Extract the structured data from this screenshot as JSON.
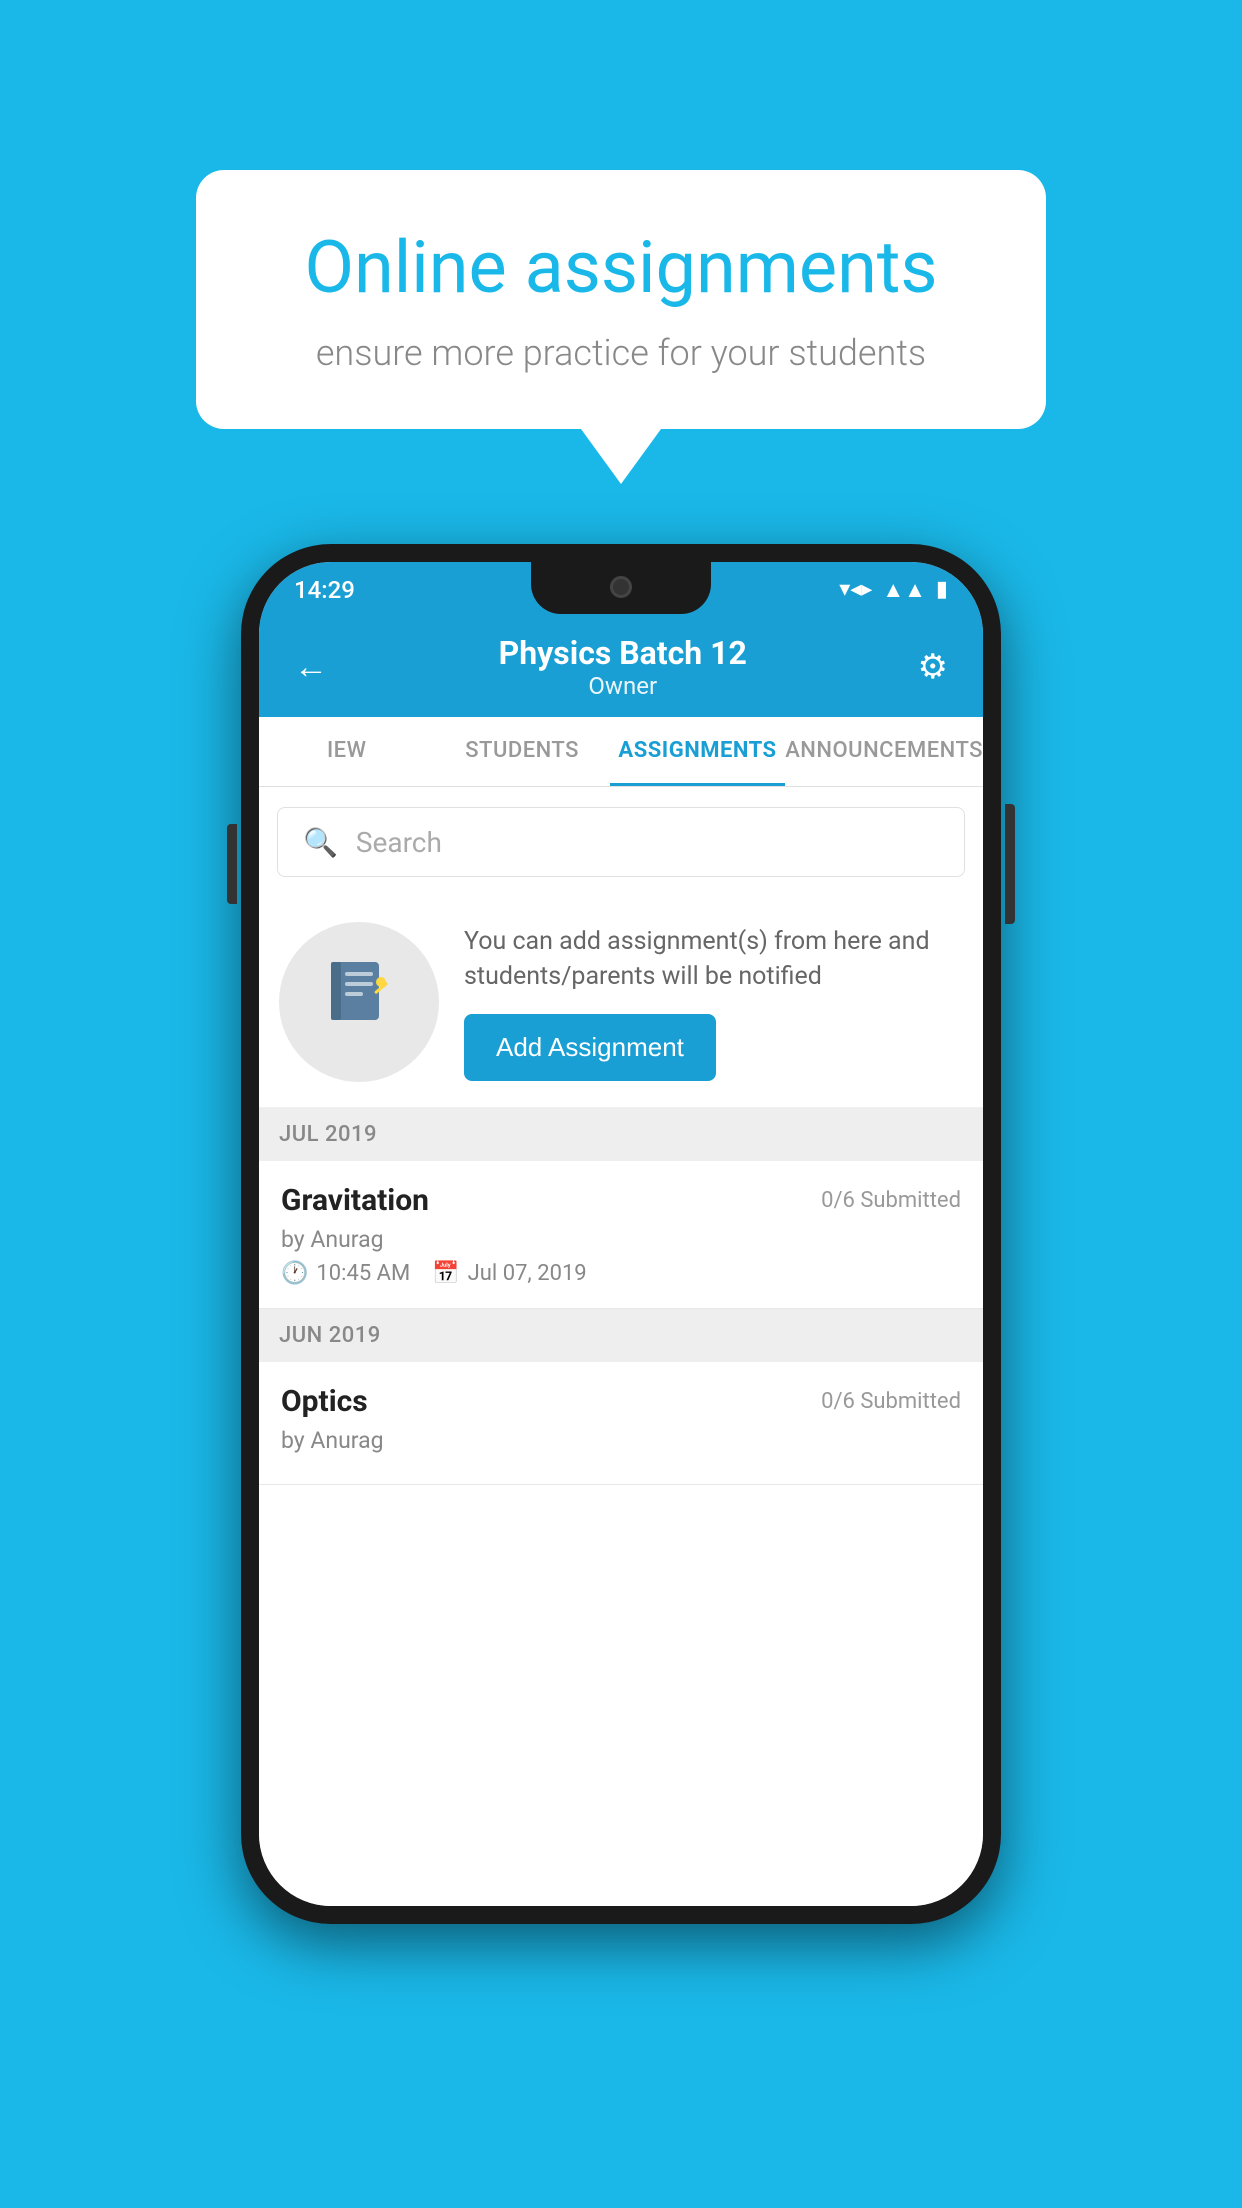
{
  "background_color": "#1ab8e8",
  "promo": {
    "title": "Online assignments",
    "subtitle": "ensure more practice for your students"
  },
  "status_bar": {
    "time": "14:29",
    "wifi_icon": "wifi",
    "signal_icon": "signal",
    "battery_icon": "battery"
  },
  "app_bar": {
    "back_icon": "←",
    "title": "Physics Batch 12",
    "subtitle": "Owner",
    "settings_icon": "⚙"
  },
  "tabs": [
    {
      "label": "IEW",
      "active": false
    },
    {
      "label": "STUDENTS",
      "active": false
    },
    {
      "label": "ASSIGNMENTS",
      "active": true
    },
    {
      "label": "ANNOUNCEMENTS",
      "active": false
    }
  ],
  "search": {
    "placeholder": "Search",
    "icon": "🔍"
  },
  "empty_state": {
    "text": "You can add assignment(s) from here and students/parents will be notified",
    "button_label": "Add Assignment",
    "icon": "📓"
  },
  "sections": [
    {
      "header": "JUL 2019",
      "items": [
        {
          "title": "Gravitation",
          "submitted": "0/6 Submitted",
          "author": "by Anurag",
          "time": "10:45 AM",
          "date": "Jul 07, 2019"
        }
      ]
    },
    {
      "header": "JUN 2019",
      "items": [
        {
          "title": "Optics",
          "submitted": "0/6 Submitted",
          "author": "by Anurag",
          "time": "",
          "date": ""
        }
      ]
    }
  ]
}
